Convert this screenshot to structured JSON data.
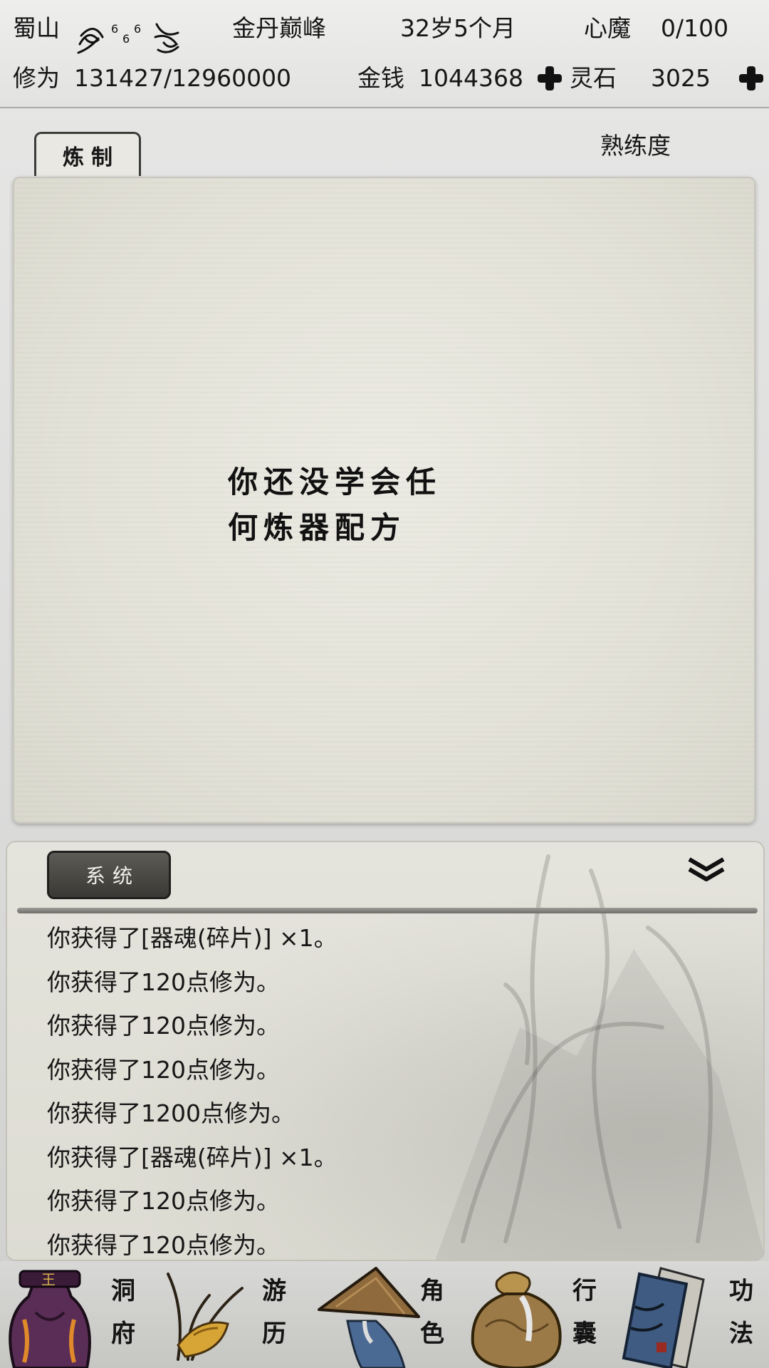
{
  "status": {
    "location": "蜀山",
    "realm": "金丹巅峰",
    "age": "32岁5个月",
    "heart_demon_label": "心魔",
    "heart_demon_value": "0/100",
    "cultivation_label": "修为",
    "cultivation_value": "131427/12960000",
    "money_label": "金钱",
    "money_value": "1044368",
    "spirit_stone_label": "灵石",
    "spirit_stone_value": "3025"
  },
  "crafting": {
    "tab_label": "炼制",
    "proficiency_label": "熟练度",
    "empty_line1": "你还没学会任",
    "empty_line2": "何炼器配方"
  },
  "log": {
    "tab_label": "系统",
    "lines": [
      "你获得了[器魂(碎片)] ×1。",
      "你获得了120点修为。",
      "你获得了120点修为。",
      "你获得了120点修为。",
      "你获得了1200点修为。",
      "你获得了[器魂(碎片)] ×1。",
      "你获得了120点修为。",
      "你获得了120点修为。"
    ]
  },
  "nav": {
    "cave_top": "洞",
    "cave_bottom": "府",
    "travel_top": "游",
    "travel_bottom": "历",
    "role_top": "角",
    "role_bottom": "色",
    "bag_top": "行",
    "bag_bottom": "囊",
    "skill_top": "功",
    "skill_bottom": "法"
  },
  "colors": {
    "ink": "#161616",
    "paper": "#e6e5dc",
    "dark_tab": "#44433f",
    "cave_purple": "#5a2d56",
    "bag_tan": "#9b7a48",
    "book_blue": "#3f5b82"
  },
  "icons": [
    "spiritual-root-icon",
    "add-money-icon",
    "add-spirit-stone-icon",
    "collapse-chevron-icon",
    "cave-icon",
    "travel-icon",
    "role-icon",
    "bag-icon",
    "skill-book-icon"
  ]
}
